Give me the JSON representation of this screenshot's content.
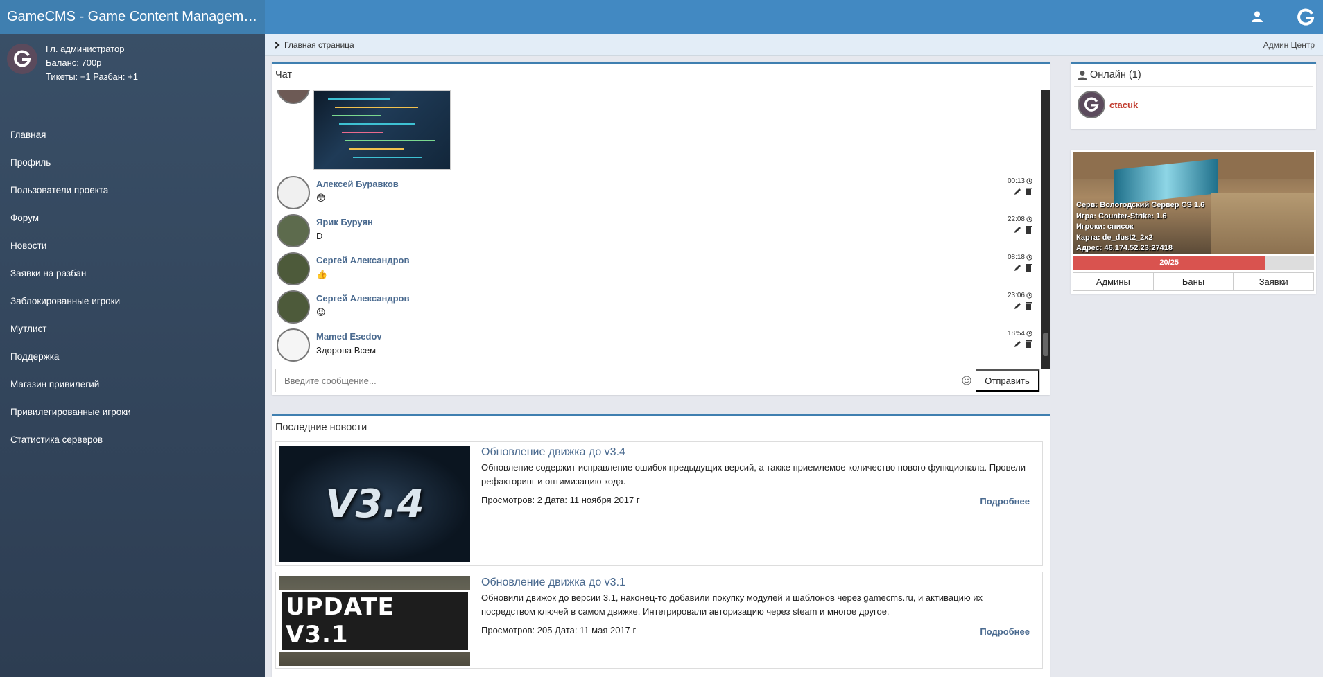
{
  "app": {
    "title": "GameCMS - Game Content Management ..."
  },
  "user": {
    "role": "Гл. администратор",
    "balance": "Баланс: 700р",
    "tickets": "Тикеты: +1 Разбан: +1"
  },
  "sidebar": {
    "items": [
      {
        "label": "Главная"
      },
      {
        "label": "Профиль"
      },
      {
        "label": "Пользователи проекта"
      },
      {
        "label": "Форум"
      },
      {
        "label": "Новости"
      },
      {
        "label": "Заявки на разбан"
      },
      {
        "label": "Заблокированные игроки"
      },
      {
        "label": "Мутлист"
      },
      {
        "label": "Поддержка"
      },
      {
        "label": "Магазин привилегий"
      },
      {
        "label": "Привилегированные игроки"
      },
      {
        "label": "Статистика серверов"
      }
    ]
  },
  "breadcrumb": {
    "current": "Главная страница",
    "admin_link": "Админ Центр"
  },
  "chat": {
    "title": "Чат",
    "messages": [
      {
        "name": "Алексей Буравков",
        "text": "😳",
        "time": "00:13"
      },
      {
        "name": "Ярик Буруян",
        "text": "D",
        "time": "22:08"
      },
      {
        "name": "Сергей Александров",
        "text": "👍",
        "time": "08:18"
      },
      {
        "name": "Сергей Александров",
        "text": "😡",
        "time": "23:06"
      },
      {
        "name": "Mamed Esedov",
        "text": "Здорова Всем",
        "time": "18:54"
      }
    ],
    "input_placeholder": "Введите сообщение...",
    "send_label": "Отправить"
  },
  "news": {
    "title": "Последние новости",
    "items": [
      {
        "title": "Обновление движка до v3.4",
        "text": "Обновление содержит исправление ошибок предыдущих версий, а также приемлемое количество нового функционала. Провели рефакторинг и оптимизацию кода.",
        "meta": "Просмотров: 2  Дата: 11 ноября 2017 г",
        "more": "Подробнее",
        "image_text": "V3.4"
      },
      {
        "title": "Обновление движка до v3.1",
        "text": "Обновили движок до версии 3.1, наконец-то добавили покупку модулей и шаблонов через gamecms.ru, и активацию их посредством ключей в самом движке. Интегрировали авторизацию через steam и многое другое.",
        "meta": "Просмотров: 205  Дата: 11 мая 2017 г",
        "more": "Подробнее",
        "image_text": "UPDATE V3.1"
      }
    ]
  },
  "online": {
    "title": "Онлайн (1)",
    "users": [
      {
        "name": "ctacuk"
      }
    ]
  },
  "server": {
    "name": "Серв:  Вологодский Сервер CS 1.6",
    "game": "Игра:  Counter-Strike: 1.6",
    "players": "Игроки:  список",
    "map": "Карта:  de_dust2_2x2",
    "address": "Адрес:  46.174.52.23:27418",
    "load": "20/25",
    "load_fraction": 0.8,
    "tabs": [
      {
        "label": "Админы"
      },
      {
        "label": "Баны"
      },
      {
        "label": "Заявки"
      }
    ]
  },
  "colors": {
    "accent": "#4289c2",
    "sidebar": "#34495e",
    "link": "#4a6a8f",
    "danger": "#d9534f"
  }
}
